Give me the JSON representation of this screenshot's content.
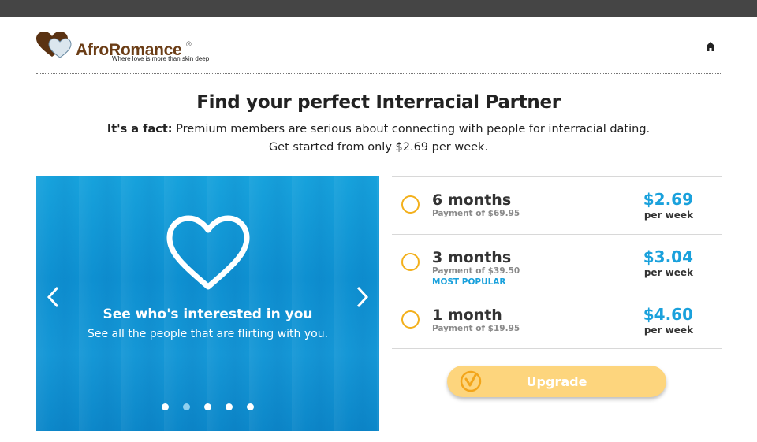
{
  "logo": {
    "name_part1": "Afro",
    "name_part2": "Romance",
    "registered": "®",
    "tagline": "Where love is more than skin deep",
    "icon": "two-hearts-logo-icon"
  },
  "nav": {
    "home_icon": "home-icon"
  },
  "headline": "Find your perfect Interracial Partner",
  "subline": {
    "fact_label": "It's a fact:",
    "fact_text": " Premium members are serious about connecting with people for interracial dating.",
    "start_text": "Get started from only $2.69 per week."
  },
  "carousel": {
    "icon": "heart-outline-icon",
    "title": "See who's interested in you",
    "subtitle": "See all the people that are flirting with you.",
    "dot_count": 5,
    "active_dot": 2
  },
  "plans": [
    {
      "name": "6 months",
      "payment": "Payment of $69.95",
      "price": "$2.69",
      "per": "per week",
      "badge": ""
    },
    {
      "name": "3 months",
      "payment": "Payment of $39.50",
      "price": "$3.04",
      "per": "per week",
      "badge": "MOST POPULAR"
    },
    {
      "name": "1 month",
      "payment": "Payment of $19.95",
      "price": "$4.60",
      "per": "per week",
      "badge": ""
    }
  ],
  "upgrade": {
    "label": "Upgrade",
    "icon": "check-circle-icon"
  },
  "colors": {
    "accent_blue": "#1aa1dc",
    "radio_orange": "#f3b01c",
    "upgrade_yellow": "#fdd57d",
    "topbar": "#454545"
  }
}
